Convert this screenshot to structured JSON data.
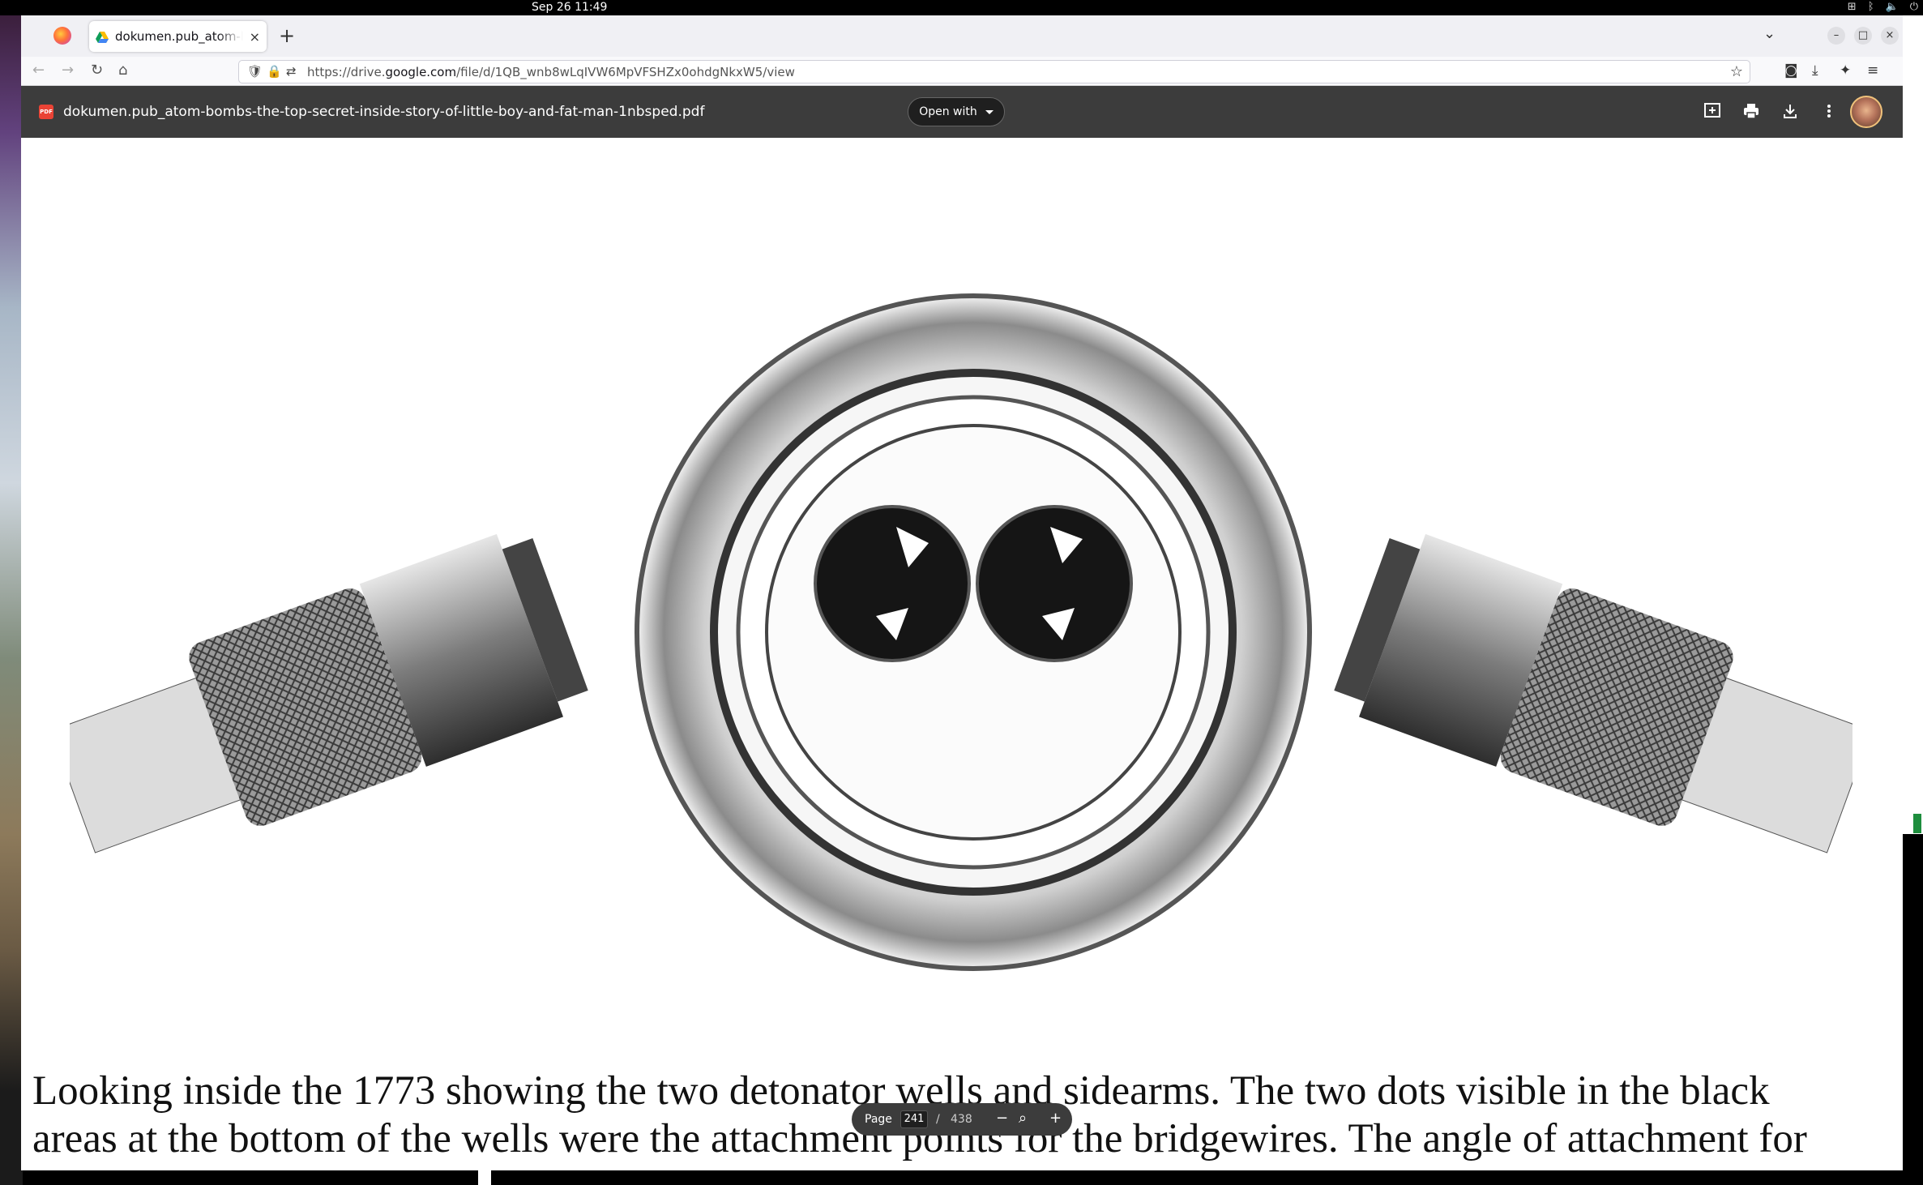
{
  "system": {
    "clock": "Sep 26  11:49",
    "icons": [
      "network-icon",
      "bluetooth-icon",
      "volume-icon",
      "power-icon"
    ]
  },
  "browser": {
    "tab": {
      "title": "dokumen.pub_atom-bom",
      "close_symbol": "×"
    },
    "new_tab_symbol": "+",
    "url": {
      "prefix": "https://drive.",
      "domain": "google.com",
      "path": "/file/d/1QB_wnb8wLqIVW6MpVFSHZx0ohdgNkxW5/view"
    }
  },
  "viewer": {
    "file_name": "dokumen.pub_atom-bombs-the-top-secret-inside-story-of-little-boy-and-fat-man-1nbsped.pdf",
    "pdf_badge": "PDF",
    "open_with_label": "Open with",
    "caption_lines": [
      "Looking inside the 1773 showing the two detonator wells and sidearms.  The two dots visible in the black",
      "areas at the bottom of the wells were the attachment points for the bridgewires. The angle of attachment for"
    ],
    "page_control": {
      "label": "Page",
      "current": "241",
      "separator": "/",
      "total": "438"
    }
  },
  "colors": {
    "viewer_header": "#3c3c3c",
    "tab_bar": "#f0f0f4",
    "pdf_red": "#ea4335"
  }
}
